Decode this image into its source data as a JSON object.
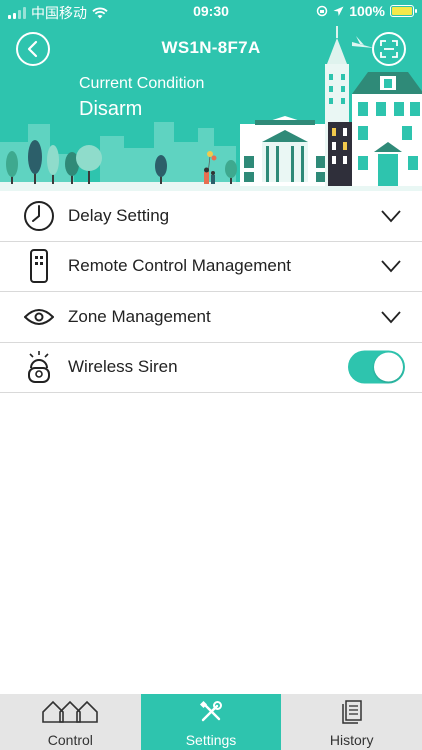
{
  "status_bar": {
    "carrier": "中国移动",
    "time": "09:30",
    "battery": "100%"
  },
  "header": {
    "title": "WS1N-8F7A",
    "condition_label": "Current Condition",
    "condition_value": "Disarm"
  },
  "settings": {
    "items": [
      {
        "label": "Delay Setting",
        "icon": "clock-icon",
        "control": "chevron"
      },
      {
        "label": "Remote Control Management",
        "icon": "remote-control-icon",
        "control": "chevron"
      },
      {
        "label": "Zone Management",
        "icon": "eye-icon",
        "control": "chevron"
      },
      {
        "label": "Wireless Siren",
        "icon": "siren-icon",
        "control": "toggle",
        "on": true
      }
    ]
  },
  "tabs": [
    {
      "label": "Control",
      "icon": "houses-icon",
      "active": false
    },
    {
      "label": "Settings",
      "icon": "tools-icon",
      "active": true
    },
    {
      "label": "History",
      "icon": "document-icon",
      "active": false
    }
  ],
  "colors": {
    "accent": "#2ec4ae",
    "tab_bg": "#e5e5e5",
    "divider": "#d9d9d9",
    "text": "#222222"
  }
}
